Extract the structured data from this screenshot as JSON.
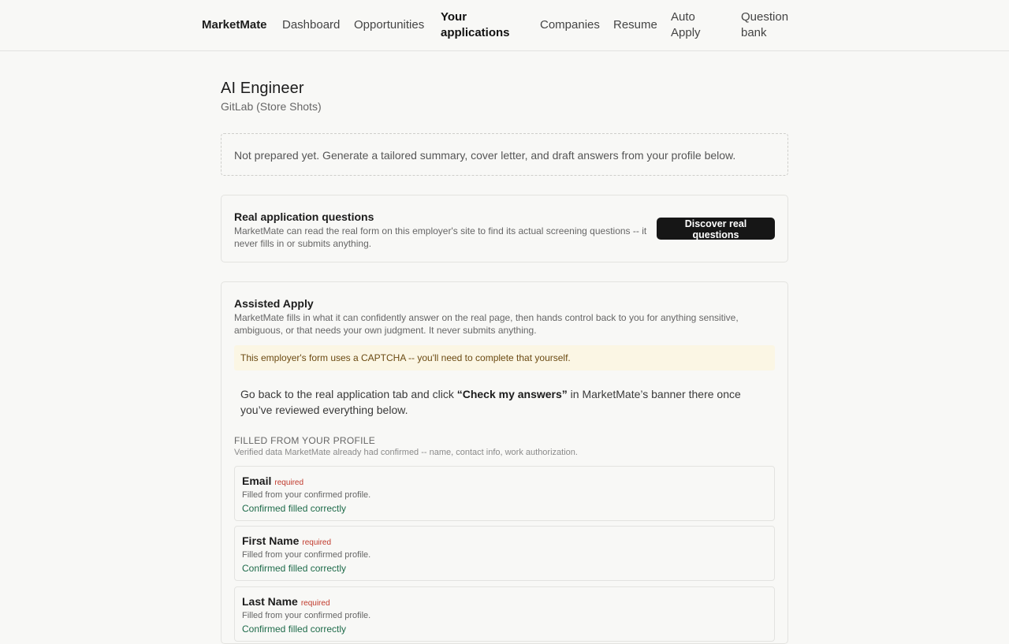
{
  "nav": {
    "brand": "MarketMate",
    "links": [
      {
        "label": "Dashboard"
      },
      {
        "label": "Opportunities"
      },
      {
        "label": "Your applications"
      },
      {
        "label": "Companies"
      },
      {
        "label": "Resume"
      },
      {
        "label": "Auto Apply"
      },
      {
        "label": "Question bank"
      }
    ],
    "active": "Your applications"
  },
  "job": {
    "title": "AI Engineer",
    "company": "GitLab (Store Shots)"
  },
  "notice": "Not prepared yet. Generate a tailored summary, cover letter, and draft answers from your profile below.",
  "real_questions": {
    "title": "Real application questions",
    "description": "MarketMate can read the real form on this employer's site to find its actual screening questions -- it never fills in or submits anything.",
    "button": "Discover real questions"
  },
  "assisted_apply": {
    "title": "Assisted Apply",
    "description": "MarketMate fills in what it can confidently answer on the real page, then hands control back to you for anything sensitive, ambiguous, or that needs your own judgment. It never submits anything.",
    "captcha_warning": "This employer's form uses a CAPTCHA -- you'll need to complete that yourself.",
    "instruction_before": "Go back to the real application tab and click ",
    "instruction_bold": "“Check my answers”",
    "instruction_after": " in MarketMate’s banner there once you’ve reviewed everything below.",
    "section_label": "FILLED FROM YOUR PROFILE",
    "section_sub": "Verified data MarketMate already had confirmed -- name, contact info, work authorization.",
    "fields": [
      {
        "name": "Email",
        "required": "required",
        "source": "Filled from your confirmed profile.",
        "status": "Confirmed filled correctly"
      },
      {
        "name": "First Name",
        "required": "required",
        "source": "Filled from your confirmed profile.",
        "status": "Confirmed filled correctly"
      },
      {
        "name": "Last Name",
        "required": "required",
        "source": "Filled from your confirmed profile.",
        "status": "Confirmed filled correctly"
      }
    ]
  }
}
